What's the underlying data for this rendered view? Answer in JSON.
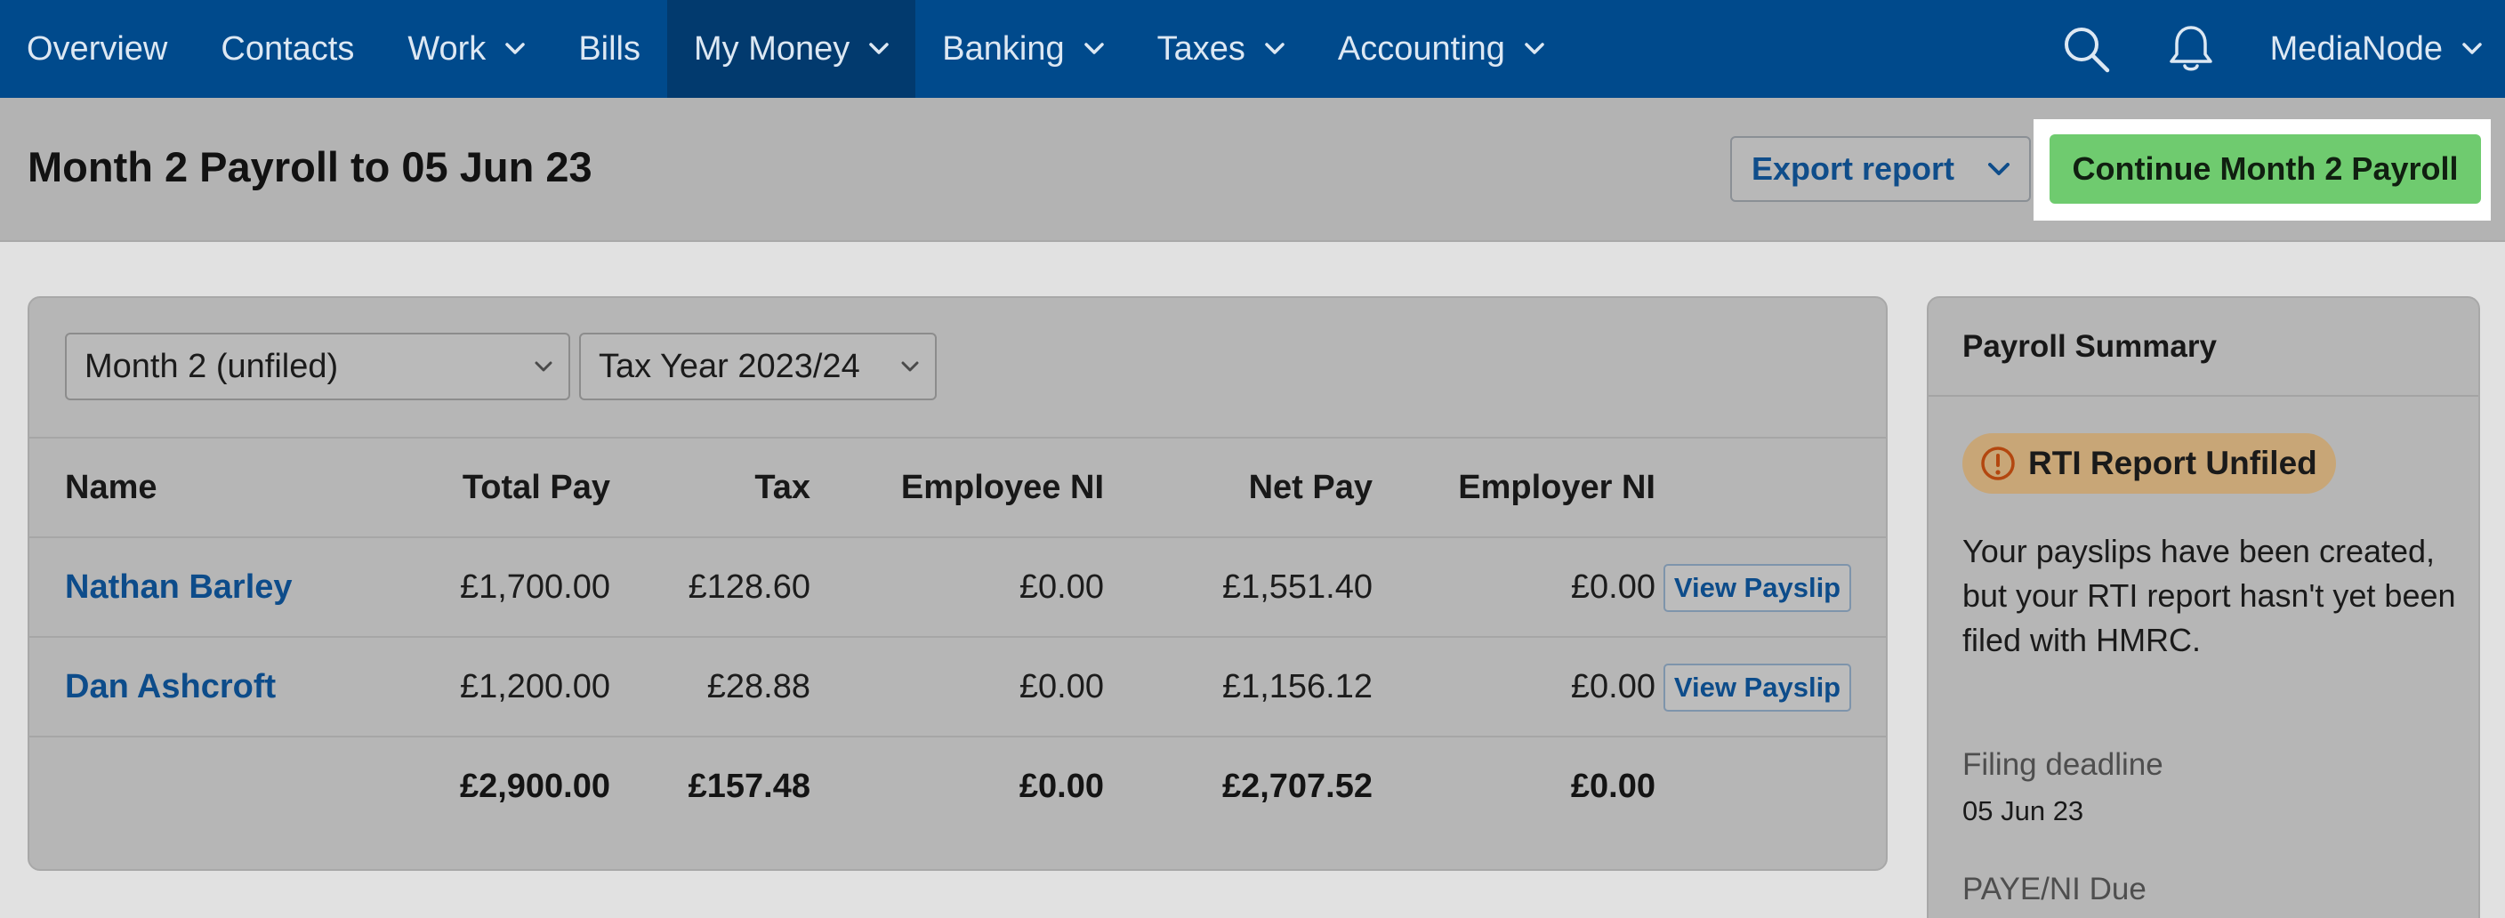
{
  "nav": {
    "items": [
      {
        "label": "Overview",
        "has_menu": false
      },
      {
        "label": "Contacts",
        "has_menu": false
      },
      {
        "label": "Work",
        "has_menu": true
      },
      {
        "label": "Bills",
        "has_menu": false
      },
      {
        "label": "My Money",
        "has_menu": true,
        "active": true
      },
      {
        "label": "Banking",
        "has_menu": true
      },
      {
        "label": "Taxes",
        "has_menu": true
      },
      {
        "label": "Accounting",
        "has_menu": true
      }
    ],
    "search_icon": "search-icon",
    "notification_icon": "bell-icon",
    "user_label": "MediaNode"
  },
  "header": {
    "title": "Month 2 Payroll to 05 Jun 23",
    "export_label": "Export report",
    "continue_label": "Continue Month 2 Payroll"
  },
  "filters": {
    "period": "Month 2 (unfiled)",
    "tax_year": "Tax Year 2023/24"
  },
  "table": {
    "headers": {
      "name": "Name",
      "total_pay": "Total Pay",
      "tax": "Tax",
      "employee_ni": "Employee NI",
      "net_pay": "Net Pay",
      "employer_ni": "Employer NI"
    },
    "rows": [
      {
        "name": "Nathan Barley",
        "total_pay": "£1,700.00",
        "tax": "£128.60",
        "employee_ni": "£0.00",
        "net_pay": "£1,551.40",
        "employer_ni": "£0.00",
        "action": "View Payslip"
      },
      {
        "name": "Dan Ashcroft",
        "total_pay": "£1,200.00",
        "tax": "£28.88",
        "employee_ni": "£0.00",
        "net_pay": "£1,156.12",
        "employer_ni": "£0.00",
        "action": "View Payslip"
      }
    ],
    "totals": {
      "total_pay": "£2,900.00",
      "tax": "£157.48",
      "employee_ni": "£0.00",
      "net_pay": "£2,707.52",
      "employer_ni": "£0.00"
    }
  },
  "summary": {
    "title": "Payroll Summary",
    "status": "RTI Report Unfiled",
    "message": "Your payslips have been created, but your RTI report hasn't yet been filed with HMRC.",
    "deadline_label": "Filing deadline",
    "deadline_value": "05 Jun 23",
    "due_label": "PAYE/NI Due"
  },
  "colors": {
    "nav_bg": "#004a8c",
    "nav_active_bg": "#023a6e",
    "primary_green": "#6fcb6f",
    "link_blue": "#0d4c8a",
    "warning_badge": "#c8a677",
    "warning_icon": "#b3470f"
  }
}
